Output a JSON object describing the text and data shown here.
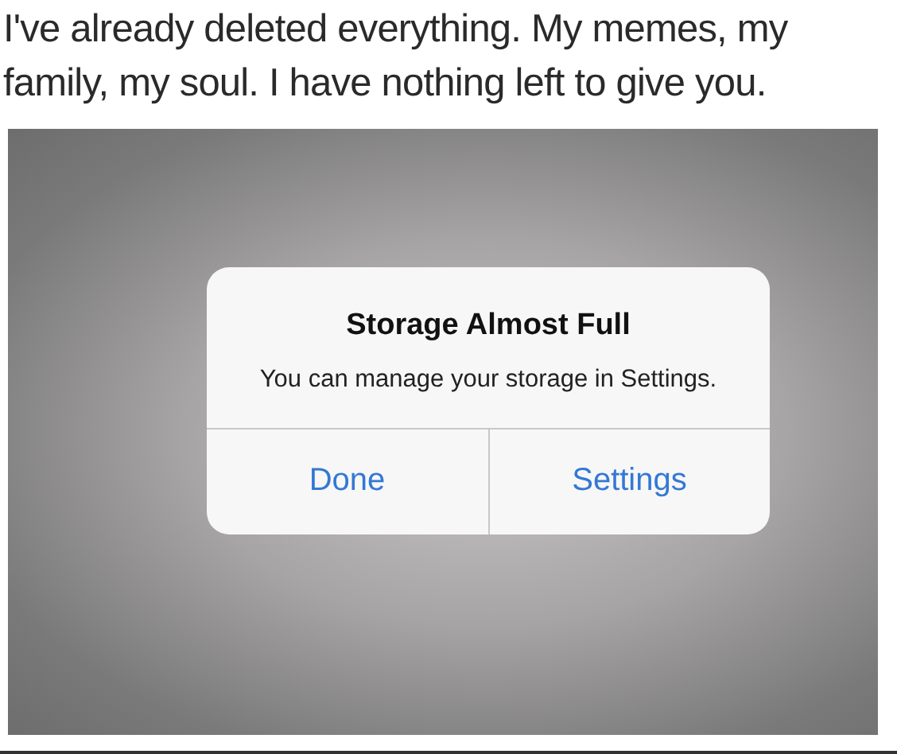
{
  "post": {
    "caption": "I've already deleted everything. My memes, my family, my soul. I have nothing left to give you."
  },
  "alert": {
    "title": "Storage Almost Full",
    "message": "You can manage your storage in Settings.",
    "buttons": [
      {
        "label": "Done",
        "bold": false
      },
      {
        "label": "Settings",
        "bold": false
      }
    ]
  }
}
